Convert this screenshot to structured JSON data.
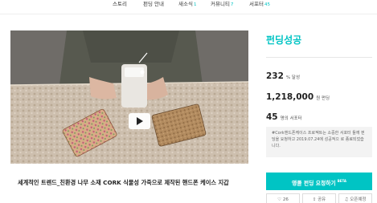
{
  "nav": {
    "items": [
      {
        "label": "스토리",
        "badge": ""
      },
      {
        "label": "펀딩 안내",
        "badge": ""
      },
      {
        "label": "새소식",
        "badge": "1"
      },
      {
        "label": "커뮤니티",
        "badge": "7"
      },
      {
        "label": "서포터",
        "badge": "45"
      }
    ]
  },
  "video": {
    "play_icon": "play-icon"
  },
  "project": {
    "title": "세계적인 트렌드_친환경 나무 소재 CORK 식물성 가죽으로 제작된 핸드폰 케이스 지갑"
  },
  "funding": {
    "status": "펀딩성공",
    "percent": "232",
    "percent_unit": "% 달성",
    "amount": "1,218,000",
    "amount_unit": "원 펀딩",
    "supporters": "45",
    "supporters_unit": "명의 서포터",
    "notice": "#Cork핸드폰케이스 프로젝트는 소중한 서포터 들께 펀딩을 요청하고 2019.07.24에 성공적으 로 종료되었습니다.",
    "cta_label": "앵콜 펀딩 요청하기",
    "cta_badge": "BETA"
  },
  "actions": [
    {
      "label": "26",
      "icon": "heart-icon"
    },
    {
      "label": "공유",
      "icon": "share-icon"
    },
    {
      "label": "오픈예정",
      "icon": "bell-icon"
    }
  ],
  "colors": {
    "accent": "#00c4c4"
  }
}
